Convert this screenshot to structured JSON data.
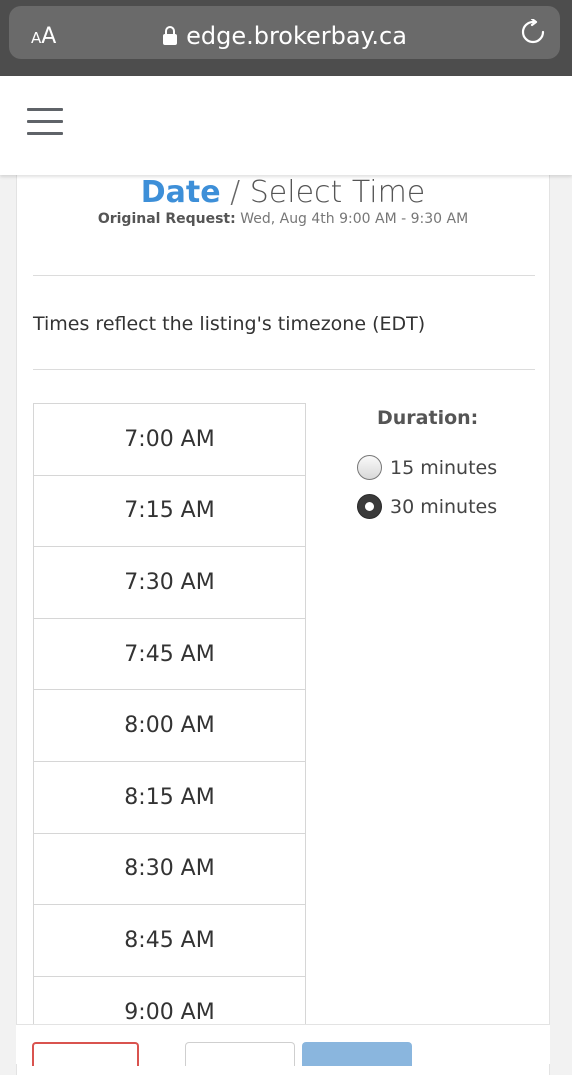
{
  "browser": {
    "aa_label_small": "A",
    "aa_label_large": "A",
    "url": "edge.brokerbay.ca"
  },
  "page": {
    "title_date": "Date",
    "title_separator": "/",
    "title_rest": "Select Time",
    "original_label": "Original Request:",
    "original_value": "Wed, Aug 4th 9:00 AM - 9:30 AM",
    "timezone_note": "Times reflect the listing's timezone (EDT)"
  },
  "slots": [
    "7:00 AM",
    "7:15 AM",
    "7:30 AM",
    "7:45 AM",
    "8:00 AM",
    "8:15 AM",
    "8:30 AM",
    "8:45 AM",
    "9:00 AM"
  ],
  "duration": {
    "label": "Duration:",
    "options": [
      {
        "label": "15 minutes",
        "selected": false
      },
      {
        "label": "30 minutes",
        "selected": true
      }
    ]
  },
  "colors": {
    "accent": "#3d8fd8",
    "cancel_border": "#d9534f",
    "next_button": "#8ab6de"
  }
}
